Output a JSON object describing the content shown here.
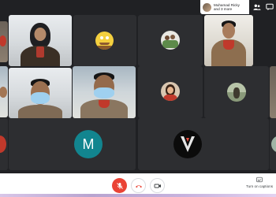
{
  "participants_chip": {
    "name_line": "Muhamad Ricky",
    "more_line": "and 3 more"
  },
  "tiles": [
    {
      "id": "edge-left-top",
      "kind": "video"
    },
    {
      "id": "hijab-woman",
      "kind": "video"
    },
    {
      "id": "spongebob",
      "kind": "avatar"
    },
    {
      "id": "group-photo",
      "kind": "avatar"
    },
    {
      "id": "scout-boy",
      "kind": "video"
    },
    {
      "id": "edge-left-mid",
      "kind": "video"
    },
    {
      "id": "masked-boy-1",
      "kind": "video"
    },
    {
      "id": "masked-boy-2",
      "kind": "video"
    },
    {
      "id": "girl-avatar",
      "kind": "avatar"
    },
    {
      "id": "forest-avatar",
      "kind": "avatar"
    },
    {
      "id": "edge-right-mid",
      "kind": "video"
    },
    {
      "id": "edge-left-bottom",
      "kind": "avatar"
    },
    {
      "id": "letter-m",
      "kind": "avatar"
    },
    {
      "id": "v-logo",
      "kind": "avatar"
    },
    {
      "id": "edge-right-bottom",
      "kind": "avatar"
    }
  ],
  "avatar_letter": "M",
  "controls": {
    "captions_label": "Turn on captions"
  },
  "colors": {
    "stage_bg": "#202124",
    "tile_bg": "#3c4043",
    "avatar_teal": "#12858f",
    "end_red": "#ea4335"
  }
}
